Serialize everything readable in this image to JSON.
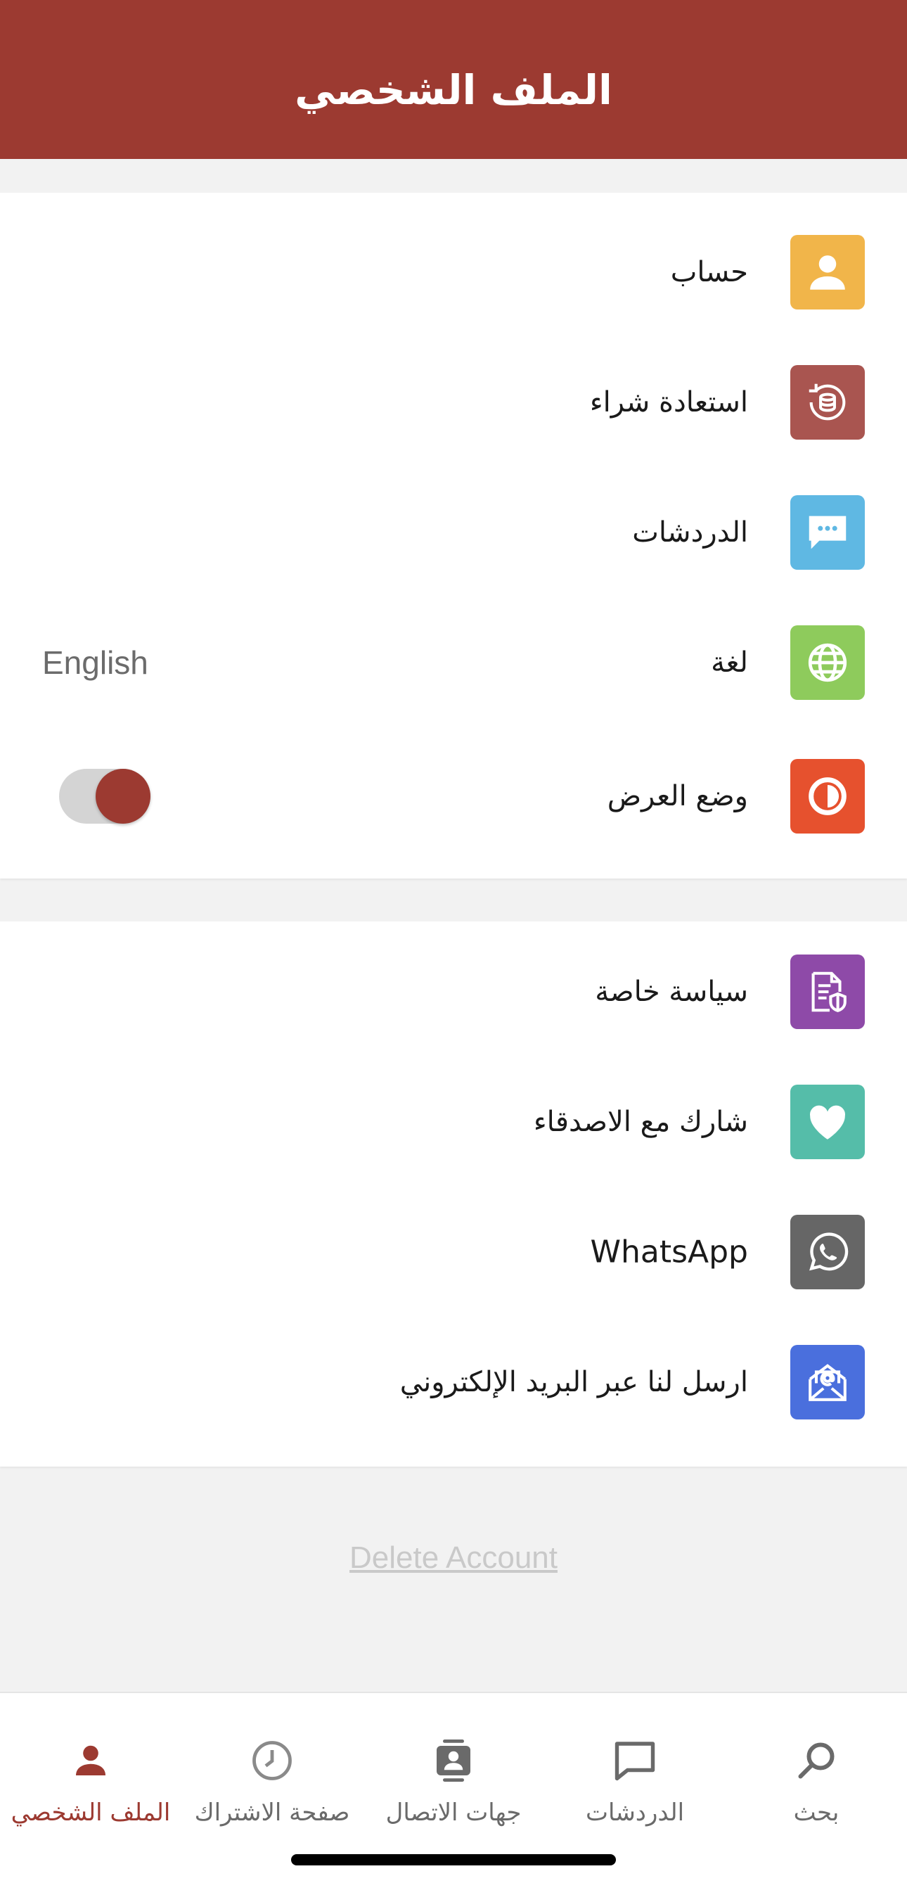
{
  "header": {
    "title": "الملف الشخصي"
  },
  "colors": {
    "brand": "#9c3a31",
    "account_icon": "#f1b54a",
    "restore_icon": "#a95550",
    "chats_icon": "#5fb8e3",
    "language_icon": "#8ecb5c",
    "display_icon": "#e6512e",
    "privacy_icon": "#8e4aa8",
    "share_icon": "#55bda9",
    "whatsapp_icon": "#666666",
    "email_icon": "#4a6fdd"
  },
  "settings": {
    "account": {
      "label": "حساب",
      "icon": "person-icon"
    },
    "restore_purchase": {
      "label": "استعادة شراء",
      "icon": "restore-database-icon"
    },
    "chats": {
      "label": "الدردشات",
      "icon": "chat-bubble-icon"
    },
    "language": {
      "label": "لغة",
      "value": "English",
      "icon": "globe-icon"
    },
    "display_mode": {
      "label": "وضع العرض",
      "icon": "contrast-icon",
      "toggle_on": true
    }
  },
  "more": {
    "privacy_policy": {
      "label": "سياسة خاصة",
      "icon": "document-shield-icon"
    },
    "share": {
      "label": "شارك مع الاصدقاء",
      "icon": "heart-icon"
    },
    "whatsapp": {
      "label": "WhatsApp",
      "icon": "whatsapp-icon"
    },
    "email": {
      "label": "ارسل لنا عبر البريد الإلكتروني",
      "icon": "email-icon"
    }
  },
  "delete_account": "Delete Account",
  "tabbar": {
    "tabs": [
      {
        "label": "الملف الشخصي",
        "icon": "person-icon",
        "active": true
      },
      {
        "label": "صفحة الاشتراك",
        "icon": "clock-icon",
        "active": false
      },
      {
        "label": "جهات الاتصال",
        "icon": "contacts-icon",
        "active": false
      },
      {
        "label": "الدردشات",
        "icon": "chat-icon",
        "active": false
      },
      {
        "label": "بحث",
        "icon": "search-icon",
        "active": false
      }
    ]
  }
}
